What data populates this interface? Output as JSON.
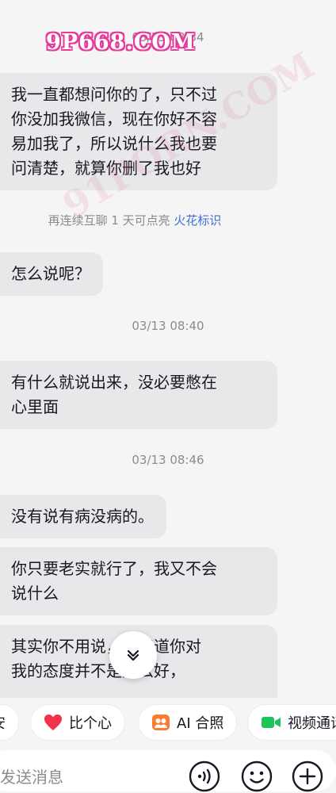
{
  "watermark": {
    "top": "9P668.COM",
    "diagonal": "91PORN.COM"
  },
  "messages": [
    {
      "time": "03/13 08:34",
      "text": "我一直都想问你的了，只不过\n你没加我微信，现在你好不容\n易加我了，所以说什么我也要\n问清楚，就算你删了我也好"
    },
    {
      "text": "怎么说呢？"
    },
    {
      "time": "03/13 08:40",
      "text": "有什么就说出来，没必要憋在\n心里面"
    },
    {
      "time": "03/13 08:46",
      "text": "没有说有病没病的。"
    },
    {
      "text": "你只要老实就行了，我又不会\n说什么"
    },
    {
      "text": "其实你不用说，我知道你对\n我的态度并不是那么好，"
    }
  ],
  "notice": {
    "text": "再连续互聊 1 天可点亮 ",
    "link": "火花标识"
  },
  "quick_actions": [
    {
      "label": "安",
      "icon": ""
    },
    {
      "label": "比个心",
      "icon": "heart-icon"
    },
    {
      "label": "AI 合照",
      "icon": "photo-icon"
    },
    {
      "label": "视频通话",
      "icon": "video-icon"
    }
  ],
  "input": {
    "placeholder": "发送消息"
  },
  "colors": {
    "bubble": "#e8e8ea",
    "link": "#3d6fd8",
    "heart": "#f0324b",
    "photo": "#ff7a2e",
    "video": "#22c25a"
  }
}
